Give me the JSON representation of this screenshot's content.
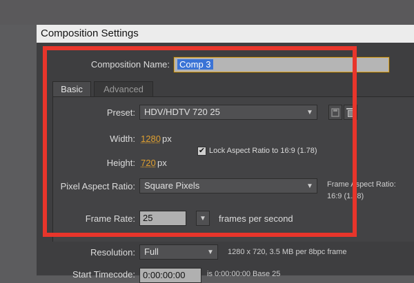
{
  "dialog": {
    "title": "Composition Settings"
  },
  "composition_name": {
    "label": "Composition Name:",
    "value": "Comp 3"
  },
  "tabs": [
    {
      "label": "Basic",
      "active": true
    },
    {
      "label": "Advanced",
      "active": false
    }
  ],
  "preset": {
    "label": "Preset:",
    "value": "HDV/HDTV 720 25"
  },
  "width": {
    "label": "Width:",
    "value": "1280",
    "unit": "px"
  },
  "height": {
    "label": "Height:",
    "value": "720",
    "unit": "px"
  },
  "lock_aspect": {
    "label": "Lock Aspect Ratio to 16:9 (1.78)",
    "checked": true
  },
  "pixel_aspect": {
    "label": "Pixel Aspect Ratio:",
    "value": "Square Pixels",
    "frame_aspect_label": "Frame Aspect Ratio:",
    "frame_aspect_value": "16:9 (1.78)"
  },
  "frame_rate": {
    "label": "Frame Rate:",
    "value": "25",
    "unit": "frames per second"
  },
  "resolution": {
    "label": "Resolution:",
    "value": "Full",
    "info": "1280 x 720, 3.5 MB per 8bpc frame"
  },
  "start_timecode": {
    "label": "Start Timecode:",
    "value": "0:00:00:00",
    "info": "is 0:00:00:00  Base 25"
  },
  "icons": {
    "dropdown": "chevron-down-icon",
    "save_preset": "save-icon",
    "delete_preset": "trash-icon",
    "checkbox": "checkmark-icon"
  },
  "colors": {
    "highlight_box": "#e8352b",
    "value_accent": "#e0a030",
    "selection": "#3a73d6"
  }
}
